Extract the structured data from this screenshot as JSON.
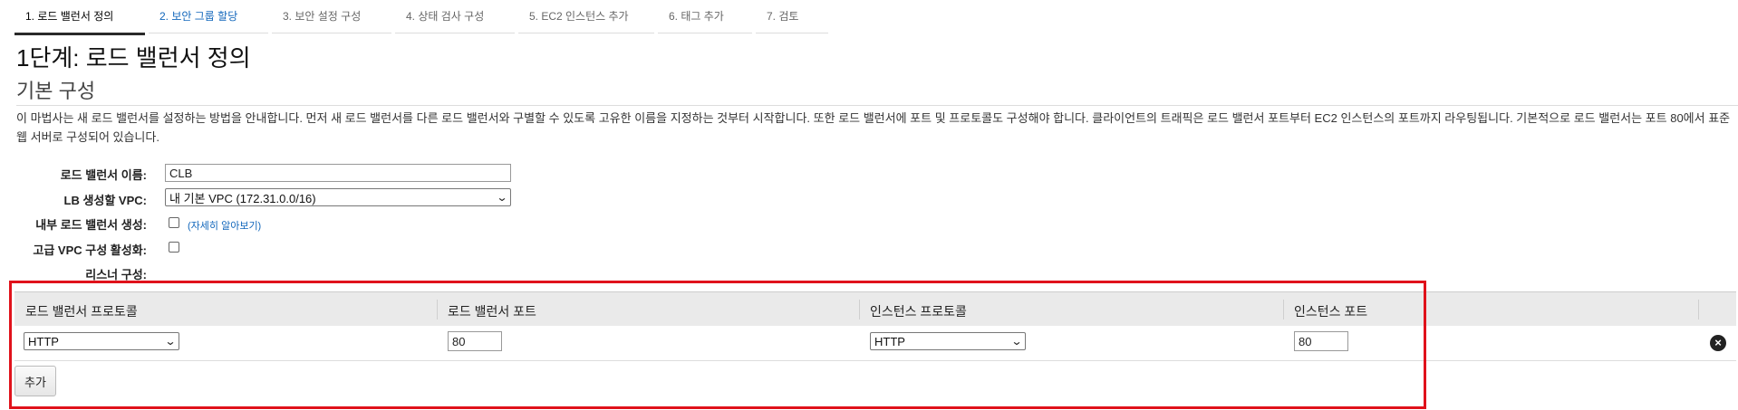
{
  "wizard_tabs": [
    {
      "label": "1. 로드 밸런서 정의",
      "state": "active"
    },
    {
      "label": "2. 보안 그룹 할당",
      "state": "next"
    },
    {
      "label": "3. 보안 설정 구성",
      "state": "inactive"
    },
    {
      "label": "4. 상태 검사 구성",
      "state": "inactive"
    },
    {
      "label": "5. EC2 인스턴스 추가",
      "state": "inactive"
    },
    {
      "label": "6. 태그 추가",
      "state": "inactive"
    },
    {
      "label": "7. 검토",
      "state": "inactive"
    }
  ],
  "page": {
    "title": "1단계: 로드 밸런서 정의",
    "section_title": "기본 구성",
    "description": "이 마법사는 새 로드 밸런서를 설정하는 방법을 안내합니다. 먼저 새 로드 밸런서를 다른 로드 밸런서와 구별할 수 있도록 고유한 이름을 지정하는 것부터 시작합니다. 또한 로드 밸런서에 포트 및 프로토콜도 구성해야 합니다. 클라이언트의 트래픽은 로드 밸런서 포트부터 EC2 인스턴스의 포트까지 라우팅됩니다. 기본적으로 로드 밸런서는 포트 80에서 표준 웹 서버로 구성되어 있습니다."
  },
  "form": {
    "name_label": "로드 밸런서 이름:",
    "name_value": "CLB",
    "vpc_label": "LB 생성할 VPC:",
    "vpc_value": "내 기본 VPC (172.31.0.0/16)",
    "internal_label": "내부 로드 밸런서 생성:",
    "internal_checked": false,
    "learn_more": "(자세히 알아보기)",
    "advanced_vpc_label": "고급 VPC 구성 활성화:",
    "advanced_vpc_checked": false,
    "listener_label": "리스너 구성:"
  },
  "listener_table": {
    "headers": [
      "로드 밸런서 프로토콜",
      "로드 밸런서 포트",
      "인스턴스 프로토콜",
      "인스턴스 포트"
    ],
    "rows": [
      {
        "lb_protocol": "HTTP",
        "lb_port": "80",
        "instance_protocol": "HTTP",
        "instance_port": "80"
      }
    ],
    "add_button": "추가"
  },
  "icons": {
    "remove": "close-circle-icon",
    "dropdown": "chevron-down-icon"
  },
  "colors": {
    "highlight": "#e0121b",
    "link": "#1166bb",
    "header_bg": "#eaeaea"
  }
}
